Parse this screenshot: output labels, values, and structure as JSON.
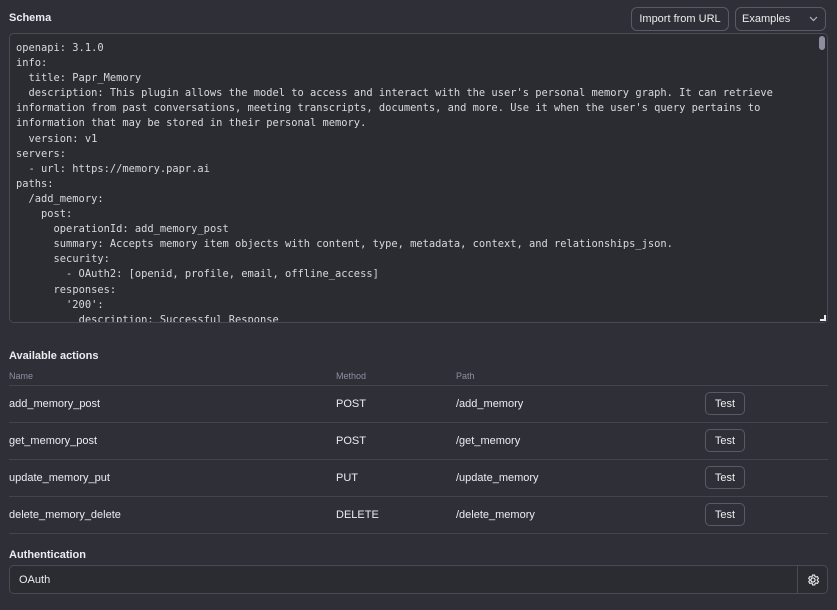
{
  "schema": {
    "title": "Schema",
    "import_label": "Import from URL",
    "examples_label": "Examples",
    "code": "openapi: 3.1.0\ninfo:\n  title: Papr_Memory\n  description: This plugin allows the model to access and interact with the user's personal memory graph. It can retrieve information from past conversations, meeting transcripts, documents, and more. Use it when the user's query pertains to information that may be stored in their personal memory.\n  version: v1\nservers:\n  - url: https://memory.papr.ai\npaths:\n  /add_memory:\n    post:\n      operationId: add_memory_post\n      summary: Accepts memory item objects with content, type, metadata, context, and relationships_json.\n      security:\n        - OAuth2: [openid, profile, email, offline_access]\n      responses:\n        '200':\n          description: Successful Response"
  },
  "actions": {
    "title": "Available actions",
    "columns": {
      "name": "Name",
      "method": "Method",
      "path": "Path"
    },
    "test_label": "Test",
    "rows": [
      {
        "name": "add_memory_post",
        "method": "POST",
        "path": "/add_memory"
      },
      {
        "name": "get_memory_post",
        "method": "POST",
        "path": "/get_memory"
      },
      {
        "name": "update_memory_put",
        "method": "PUT",
        "path": "/update_memory"
      },
      {
        "name": "delete_memory_delete",
        "method": "DELETE",
        "path": "/delete_memory"
      }
    ]
  },
  "authentication": {
    "title": "Authentication",
    "value": "OAuth",
    "settings_icon": "gear-icon"
  }
}
